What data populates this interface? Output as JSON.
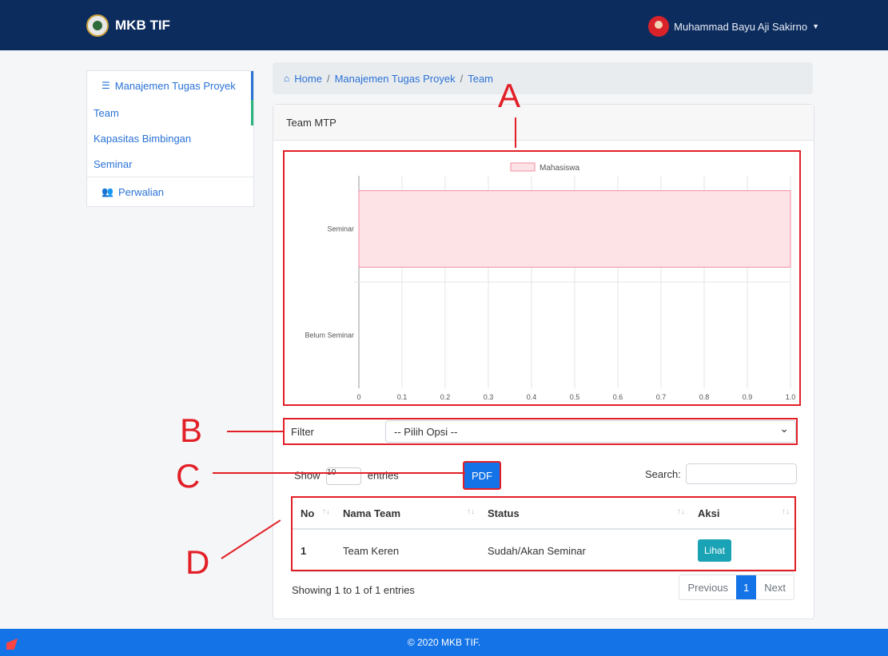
{
  "brand": "MKB TIF",
  "user": {
    "name": "Muhammad Bayu Aji Sakirno"
  },
  "sidebar": {
    "section": "Manajemen Tugas Proyek",
    "items": [
      "Team",
      "Kapasitas Bimbingan",
      "Seminar"
    ],
    "perwalian": "Perwalian"
  },
  "breadcrumb": [
    "Home",
    "Manajemen Tugas Proyek",
    "Team"
  ],
  "card_title": "Team MTP",
  "chart_data": {
    "type": "bar",
    "orientation": "horizontal",
    "legend": "Mahasiswa",
    "categories": [
      "Seminar",
      "Belum Seminar"
    ],
    "series": [
      {
        "name": "Mahasiswa",
        "values": [
          1,
          0
        ]
      }
    ],
    "ticks": [
      "0",
      "0.1",
      "0.2",
      "0.3",
      "0.4",
      "0.5",
      "0.6",
      "0.7",
      "0.8",
      "0.9",
      "1.0"
    ],
    "xlim": [
      0,
      1
    ],
    "grid": true,
    "colors": {
      "fill": "#fde2e6",
      "stroke": "#f28ea1"
    }
  },
  "filter": {
    "label": "Filter",
    "selected": "-- Pilih Opsi --"
  },
  "table_controls": {
    "show_prefix": "Show",
    "show_value": "10",
    "show_suffix": "entries",
    "search_label": "Search:",
    "pdf": "PDF"
  },
  "table": {
    "headers": [
      "No",
      "Nama Team",
      "Status",
      "Aksi"
    ],
    "rows": [
      {
        "no": "1",
        "nama": "Team Keren",
        "status": "Sudah/Akan Seminar",
        "aksi": "Lihat"
      }
    ]
  },
  "info": "Showing 1 to 1 of 1 entries",
  "pagination": {
    "prev": "Previous",
    "current": "1",
    "next": "Next"
  },
  "footer": "© 2020 MKB TIF.",
  "annotations": [
    "A",
    "B",
    "C",
    "D"
  ],
  "colors": {
    "navbar": "#0d2c5e",
    "primary": "#1473e6",
    "annotation": "#e21f26"
  }
}
